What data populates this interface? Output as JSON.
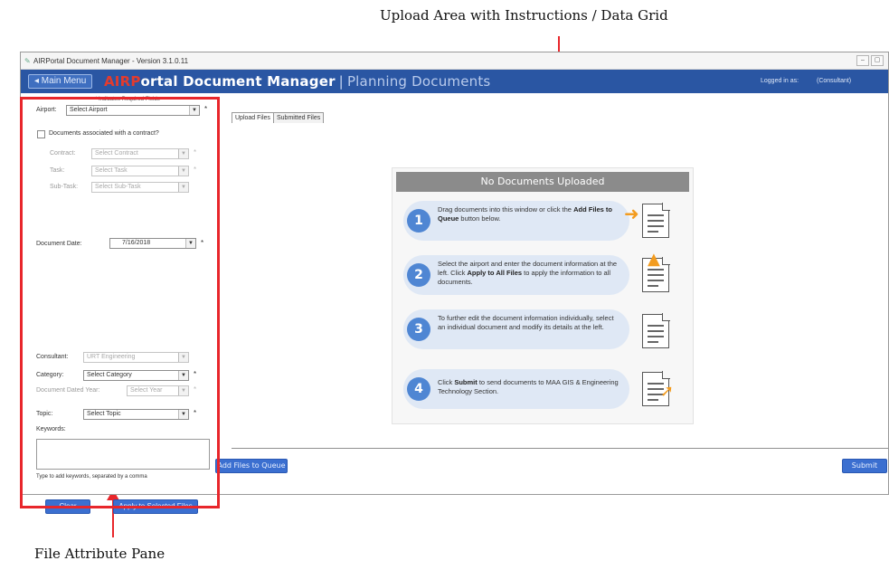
{
  "annotations": {
    "top_caption": "Upload Area with Instructions / Data Grid",
    "bottom_caption": "File Attribute Pane",
    "arrow_color": "#e8262b"
  },
  "window": {
    "title": "AIRPortal Document Manager - Version 3.1.0.11",
    "controls": [
      "–",
      "▢"
    ]
  },
  "header": {
    "main_menu_label": "◂ Main Menu",
    "app_title_air": "AIRP",
    "app_title_rest": "ortal Document Manager",
    "separator": "|",
    "section": "Planning Documents",
    "logged_in": "Logged in as:",
    "role": "(Consultant)",
    "bar_color": "#2a56a3"
  },
  "left_pane": {
    "required_note": "* Indicates Required Fields",
    "airport_label": "Airport:",
    "airport_value": "Select Airport",
    "contract_checkbox_label": "Documents associated with a contract?",
    "contract_label": "Contract:",
    "contract_value": "Select Contract",
    "task_label": "Task:",
    "task_value": "Select Task",
    "subtask_label": "Sub-Task:",
    "subtask_value": "Select Sub-Task",
    "document_date_label": "Document Date:",
    "document_date_value": "7/16/2018",
    "consultant_label": "Consultant:",
    "consultant_value": "URT Engineering",
    "category_label": "Category:",
    "category_value": "Select Category",
    "fiscal_year_label": "Document Dated Year:",
    "fiscal_year_value": "Select Year",
    "topic_label": "Topic:",
    "topic_value": "Select Topic",
    "keywords_label": "Keywords:",
    "keywords_hint": "Type to add keywords, separated by a comma",
    "clear_button": "Clear",
    "apply_button": "Apply to Selected Files",
    "required_star": "*"
  },
  "main": {
    "tabs": [
      {
        "label": "Upload Files"
      },
      {
        "label": "Submitted Files"
      }
    ],
    "panel_title": "No Documents Uploaded",
    "steps": [
      {
        "number": "1",
        "pre": "Drag documents into this window or click the ",
        "bold": "Add Files to Queue",
        "post": " button below."
      },
      {
        "number": "2",
        "pre": "Select the airport and enter the document information at the left. Click ",
        "bold": "Apply to All Files",
        "post": " to apply the information to all documents."
      },
      {
        "number": "3",
        "pre": "To further edit the document information individually, select an individual document and modify its details at the left.",
        "bold": "",
        "post": ""
      },
      {
        "number": "4",
        "pre": "Click ",
        "bold": "Submit",
        "post": " to send documents to MAA GIS & Engineering Technology Section."
      }
    ],
    "add_files_button": "Add Files to Queue",
    "submit_button": "Submit",
    "accent_color": "#4f86d3"
  }
}
